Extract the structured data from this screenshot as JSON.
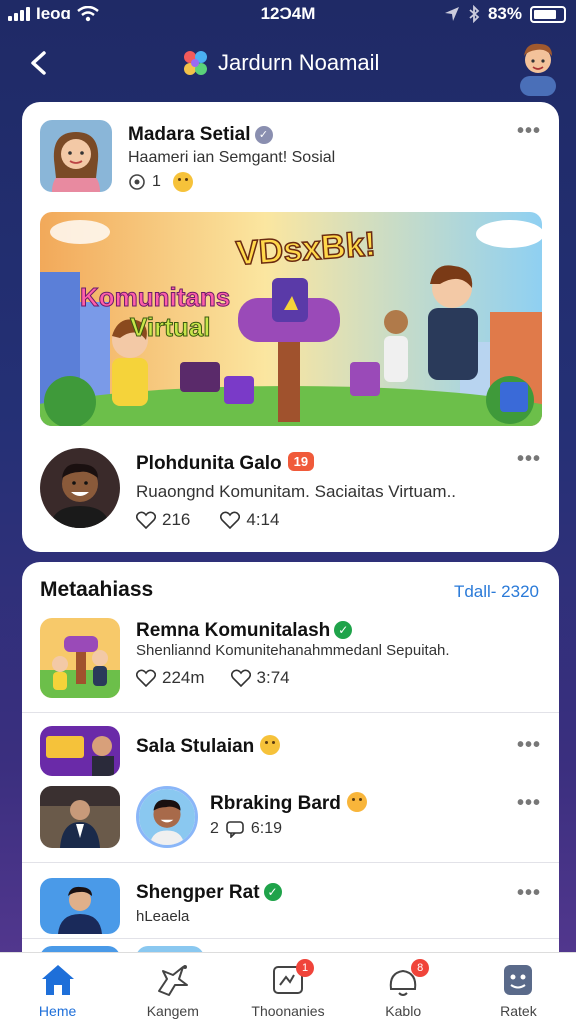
{
  "status_bar": {
    "carrier": "Ieoɑ",
    "time": "12Ɔ4M",
    "battery": "83%"
  },
  "header": {
    "title": "Jardurn Noamail"
  },
  "featured_post": {
    "author": "Madara Setial",
    "subtitle": "Haameri ian Semgant! Sosial",
    "meta": "1",
    "banner": {
      "logo_text": "VDsxBk!",
      "line1": "Komunitans",
      "line2": "Virtual"
    }
  },
  "second_post": {
    "author": "Plohdunita Galo",
    "badge": "19",
    "text": "Ruaongnd Komunitam. Saciaitas Virtuam..",
    "comments": "216",
    "likes": "4:14"
  },
  "list_section": {
    "title": "Metaahiass",
    "link": "Tdall- 2320",
    "items": [
      {
        "name": "Remna Komunitalash",
        "text": "Shenliannd Komunitehanahmmedanl Sepuitah.",
        "comments": "224m",
        "likes": "3:74"
      },
      {
        "name": "Sala Stulaian"
      },
      {
        "name": "Rbraking Bard",
        "meta_a": "2",
        "meta_b": "6:19"
      },
      {
        "name": "Shengper Rat",
        "text": "hLeaela"
      }
    ]
  },
  "bottom_nav": [
    {
      "label": "Heme",
      "icon": "home-icon",
      "active": true
    },
    {
      "label": "Kangem",
      "icon": "explore-icon"
    },
    {
      "label": "Thoonanies",
      "icon": "notifications-icon",
      "badge": "1"
    },
    {
      "label": "Kablo",
      "icon": "chat-icon",
      "badge": "8"
    },
    {
      "label": "Ratek",
      "icon": "profile-icon"
    }
  ],
  "colors": {
    "background": "#243075",
    "accent": "#1e6fd9",
    "verified": "#1fa34a",
    "badge": "#f05a3a"
  }
}
